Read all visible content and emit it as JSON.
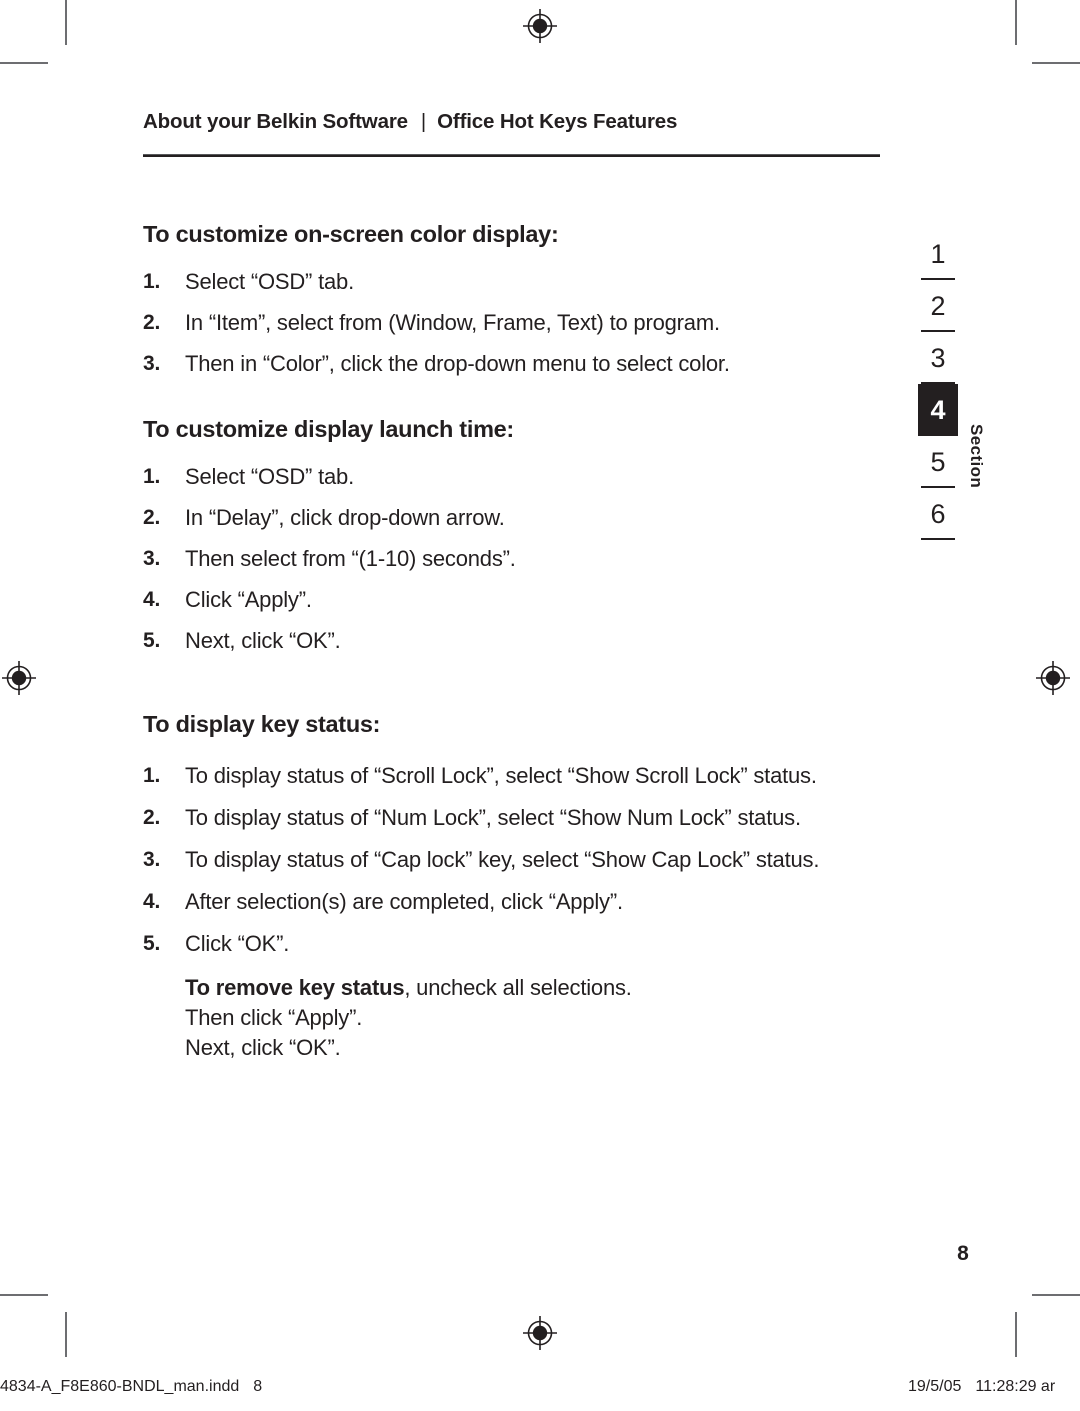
{
  "header": {
    "left": "About your Belkin Software",
    "separator": "|",
    "right": "Office Hot Keys Features"
  },
  "sections": [
    {
      "heading": "To customize on-screen color display:",
      "steps": [
        {
          "num": "1.",
          "text": "Select “OSD” tab."
        },
        {
          "num": "2.",
          "text": "In “Item”, select from (Window, Frame, Text) to program."
        },
        {
          "num": "3.",
          "text": "Then in “Color”, click the drop-down menu to select color."
        }
      ]
    },
    {
      "heading": "To customize display launch time:",
      "steps": [
        {
          "num": "1.",
          "text": "Select “OSD” tab."
        },
        {
          "num": "2.",
          "text": "In “Delay”, click drop-down arrow."
        },
        {
          "num": "3.",
          "text": "Then select from “(1-10) seconds”."
        },
        {
          "num": "4.",
          "text": "Click “Apply”."
        },
        {
          "num": "5.",
          "text": "Next, click “OK”."
        }
      ]
    },
    {
      "heading": "To display key status:",
      "steps": [
        {
          "num": "1.",
          "text": "To display status of “Scroll Lock”, select “Show Scroll Lock” status."
        },
        {
          "num": "2.",
          "text": "To display status of “Num Lock”, select “Show Num Lock” status."
        },
        {
          "num": "3.",
          "text": "To display status of “Cap lock” key, select “Show Cap Lock” status."
        },
        {
          "num": "4.",
          "text": "After selection(s) are completed, click “Apply”."
        },
        {
          "num": "5.",
          "text": "Click “OK”."
        }
      ],
      "note": {
        "bold": "To remove key status",
        "rest": ", uncheck all selections.",
        "line2": "Then click “Apply”.",
        "line3": "Next, click “OK”."
      }
    }
  ],
  "rail": {
    "label": "Section",
    "items": [
      {
        "num": "1",
        "active": false
      },
      {
        "num": "2",
        "active": false
      },
      {
        "num": "3",
        "active": false
      },
      {
        "num": "4",
        "active": true
      },
      {
        "num": "5",
        "active": false
      },
      {
        "num": "6",
        "active": false
      }
    ]
  },
  "folio": "8",
  "slug": {
    "file": "4834-A_F8E860-BNDL_man.indd",
    "page": "8",
    "date": "19/5/05",
    "time": "11:28:29 ar"
  },
  "colors": {
    "ink": "#231f20",
    "mark": "#6d6e71",
    "paper": "#ffffff"
  }
}
